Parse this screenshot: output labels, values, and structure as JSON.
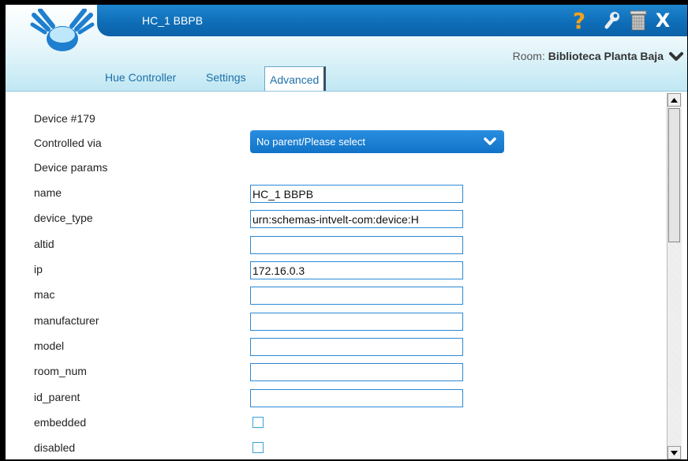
{
  "window": {
    "title": "HC_1 BBPB",
    "icons": [
      "help-icon",
      "wrench-icon",
      "trash-icon",
      "close-icon"
    ],
    "help_glyph": "?",
    "close_glyph": "X"
  },
  "header": {
    "room_label": "Room: ",
    "room_name": "Biblioteca Planta Baja",
    "tabs": [
      {
        "label": "Hue Controller"
      },
      {
        "label": "Settings"
      },
      {
        "label": "Advanced",
        "active": true
      }
    ]
  },
  "device": {
    "title": "Device #179",
    "controlled_via_label": "Controlled via",
    "controlled_via_value": "No parent/Please select",
    "params_label": "Device params",
    "params": [
      {
        "label": "name",
        "value": "HC_1 BBPB"
      },
      {
        "label": "device_type",
        "value": "urn:schemas-intvelt-com:device:H"
      },
      {
        "label": "altid",
        "value": ""
      },
      {
        "label": "ip",
        "value": "172.16.0.3"
      },
      {
        "label": "mac",
        "value": ""
      },
      {
        "label": "manufacturer",
        "value": ""
      },
      {
        "label": "model",
        "value": ""
      },
      {
        "label": "room_num",
        "value": ""
      },
      {
        "label": "id_parent",
        "value": ""
      }
    ],
    "checkboxes": [
      {
        "label": "embedded",
        "checked": false
      },
      {
        "label": "disabled",
        "checked": false
      }
    ]
  },
  "colors": {
    "titlebar": "#0e6cb6",
    "accent": "#2c8ad6",
    "help": "#f6a21a"
  }
}
